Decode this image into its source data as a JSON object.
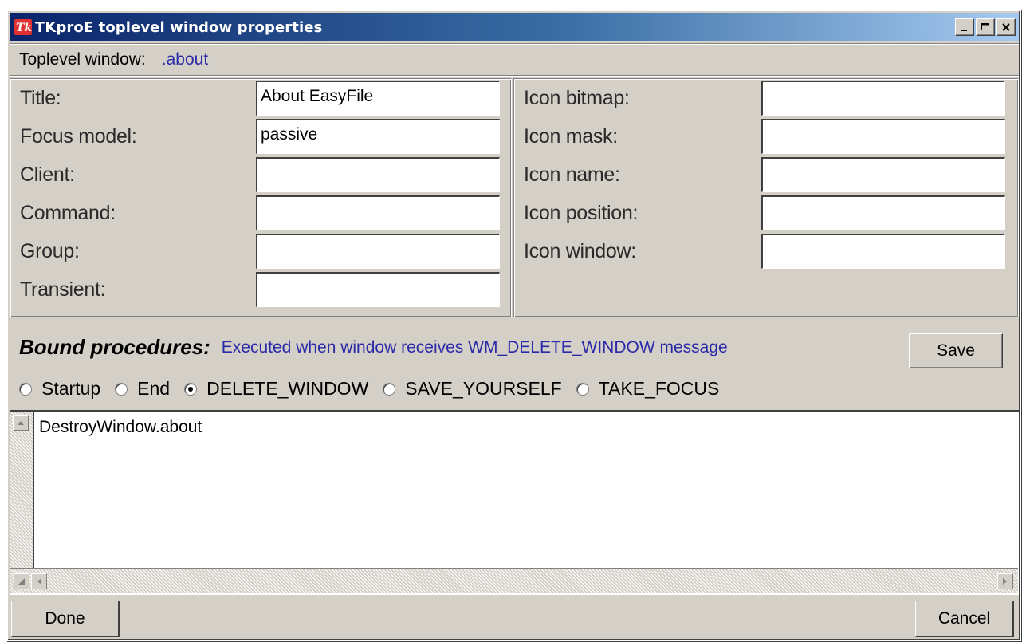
{
  "window": {
    "title": "TKproE toplevel window properties",
    "buttons": {
      "minimize": "_",
      "maximize": "□",
      "close": "X"
    }
  },
  "toplevel": {
    "label": "Toplevel window:",
    "value": ".about"
  },
  "left_fields": [
    {
      "label": "Title:",
      "value": "About EasyFile"
    },
    {
      "label": "Focus model:",
      "value": "passive"
    },
    {
      "label": "Client:",
      "value": ""
    },
    {
      "label": "Command:",
      "value": ""
    },
    {
      "label": "Group:",
      "value": ""
    },
    {
      "label": "Transient:",
      "value": ""
    }
  ],
  "right_fields": [
    {
      "label": "Icon bitmap:",
      "value": ""
    },
    {
      "label": "Icon mask:",
      "value": ""
    },
    {
      "label": "Icon name:",
      "value": ""
    },
    {
      "label": "Icon position:",
      "value": ""
    },
    {
      "label": "Icon window:",
      "value": ""
    }
  ],
  "bound": {
    "label": "Bound procedures:",
    "description": "Executed when window receives WM_DELETE_WINDOW message",
    "save_label": "Save"
  },
  "radios": [
    {
      "label": "Startup",
      "checked": false
    },
    {
      "label": "End",
      "checked": false
    },
    {
      "label": "DELETE_WINDOW",
      "checked": true
    },
    {
      "label": "SAVE_YOURSELF",
      "checked": false
    },
    {
      "label": "TAKE_FOCUS",
      "checked": false
    }
  ],
  "editor": {
    "content": "DestroyWindow.about"
  },
  "footer": {
    "done_label": "Done",
    "cancel_label": "Cancel"
  },
  "colors": {
    "titlebar_start": "#0a246a",
    "titlebar_end": "#a6caf0",
    "accent_text": "#2a2aa8",
    "face": "#d4d0c8"
  },
  "icons": {
    "app": "tk-feather-icon"
  }
}
